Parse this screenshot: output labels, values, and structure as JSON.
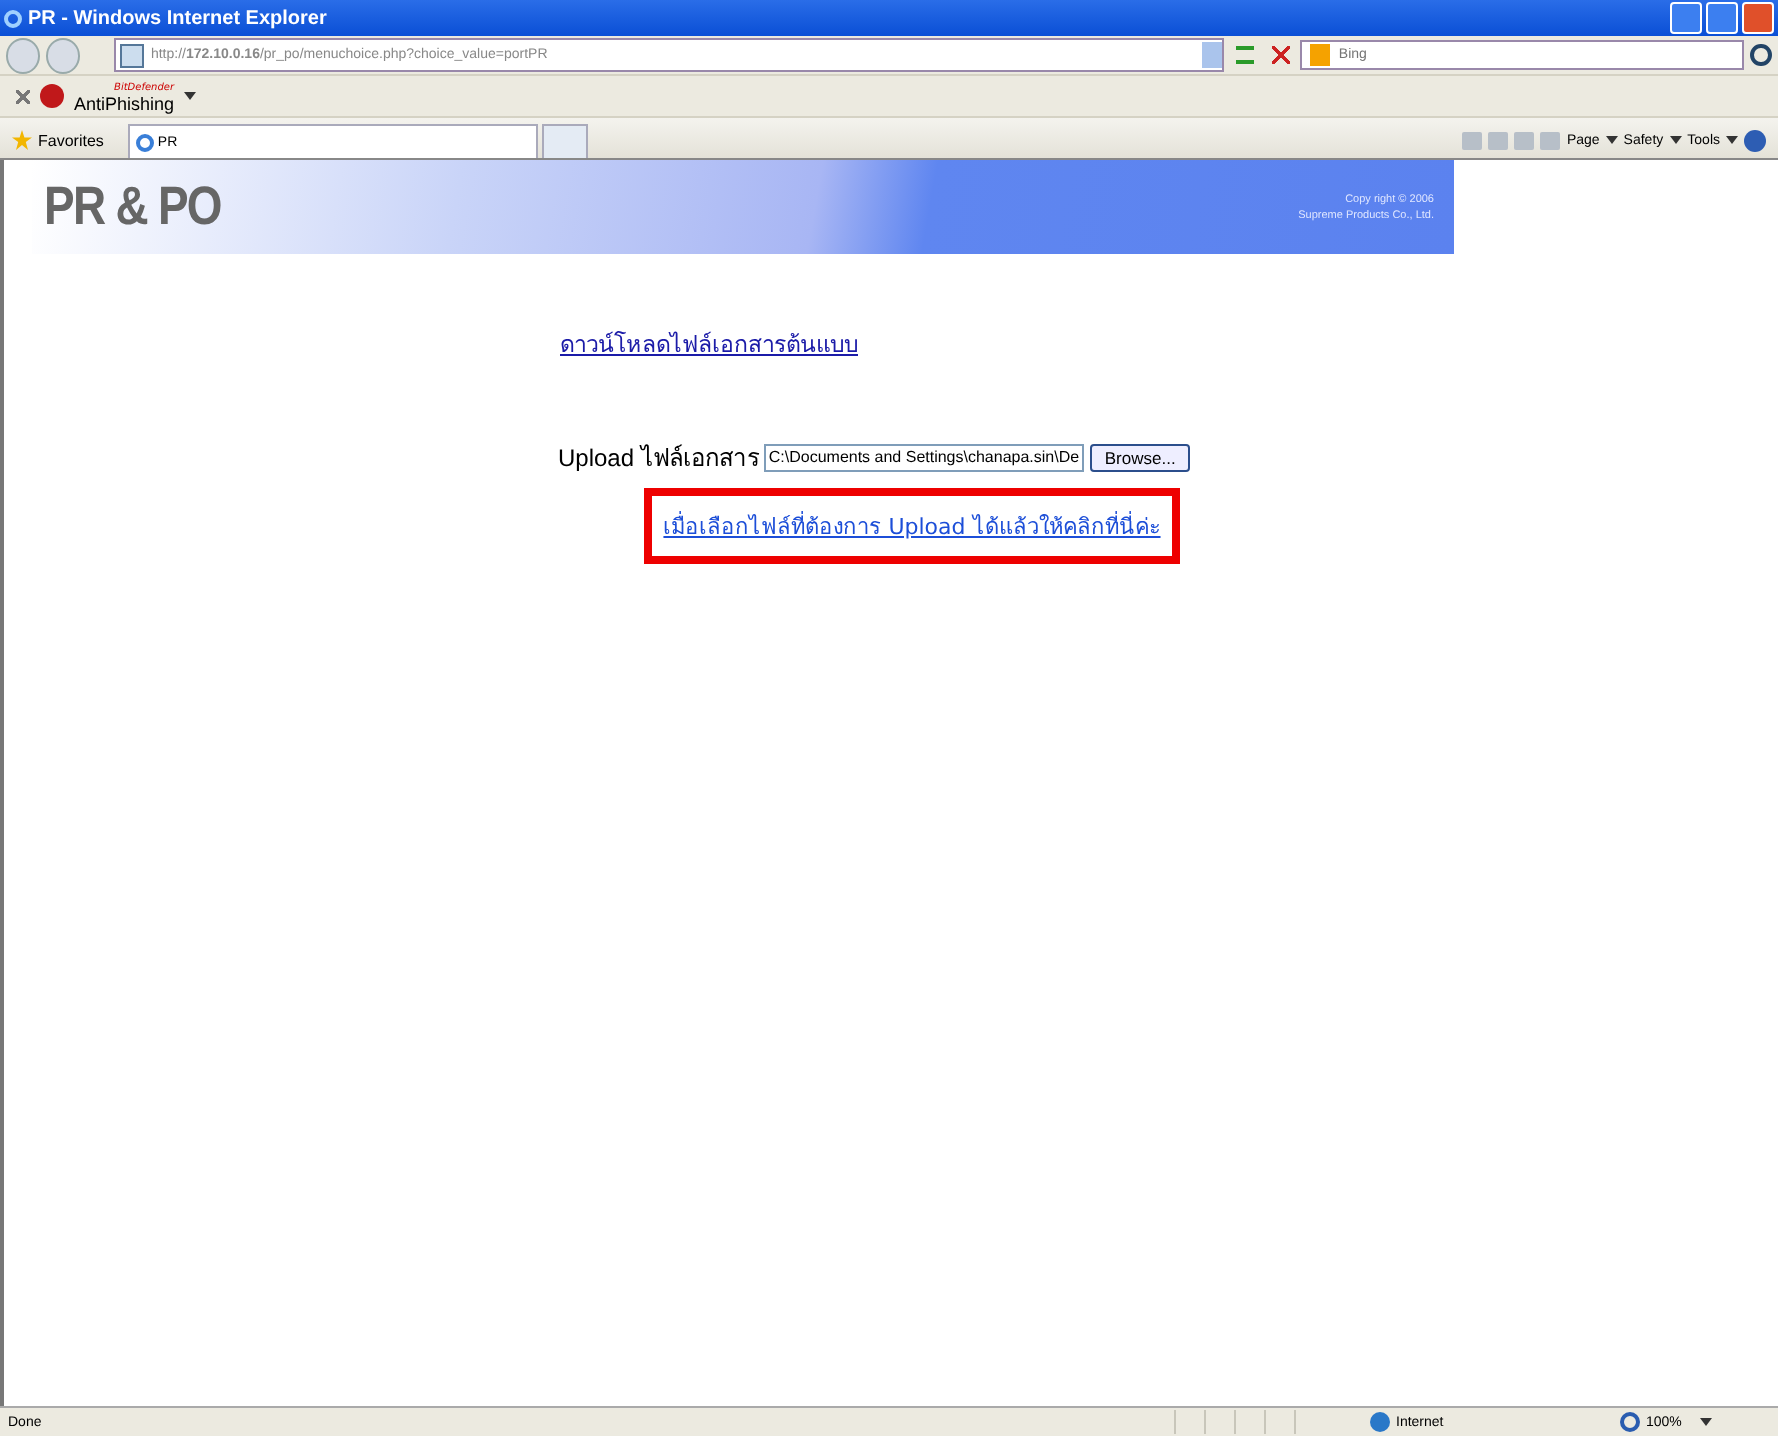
{
  "window": {
    "title": "PR - Windows Internet Explorer"
  },
  "address_bar": {
    "url": "http://**172.10.0.16**/pr_po/menuchoice.php?choice_value=portPR"
  },
  "search": {
    "placeholder": "Bing"
  },
  "addon_toolbar": {
    "label": "AntiPhishing",
    "brand": "BitDefender"
  },
  "favorites_bar": {
    "favorites": "Favorites",
    "tabs": [
      {
        "label": "PR",
        "selected": true
      }
    ],
    "commands": [
      "Page",
      "Safety",
      "Tools"
    ]
  },
  "banner": {
    "title": "PR & PO",
    "copyright": [
      "Copy right © 2006",
      "Supreme Products Co., Ltd."
    ]
  },
  "download_link": "ดาวน์โหลดไฟล์เอกสารต้นแบบ",
  "upload": {
    "label": "Upload ไฟล์เอกสาร",
    "value": "C:\\Documents and Settings\\chanapa.sin\\De",
    "button": "Browse..."
  },
  "upload_link": {
    "text": "เมื่อเลือกไฟล์ที่ต้องการ Upload ได้แล้วให้คลิกที่นี่ค่ะ",
    "highlighted": true
  },
  "status_bar": {
    "status": "Done",
    "zone": "Internet",
    "zoom": "100%"
  }
}
